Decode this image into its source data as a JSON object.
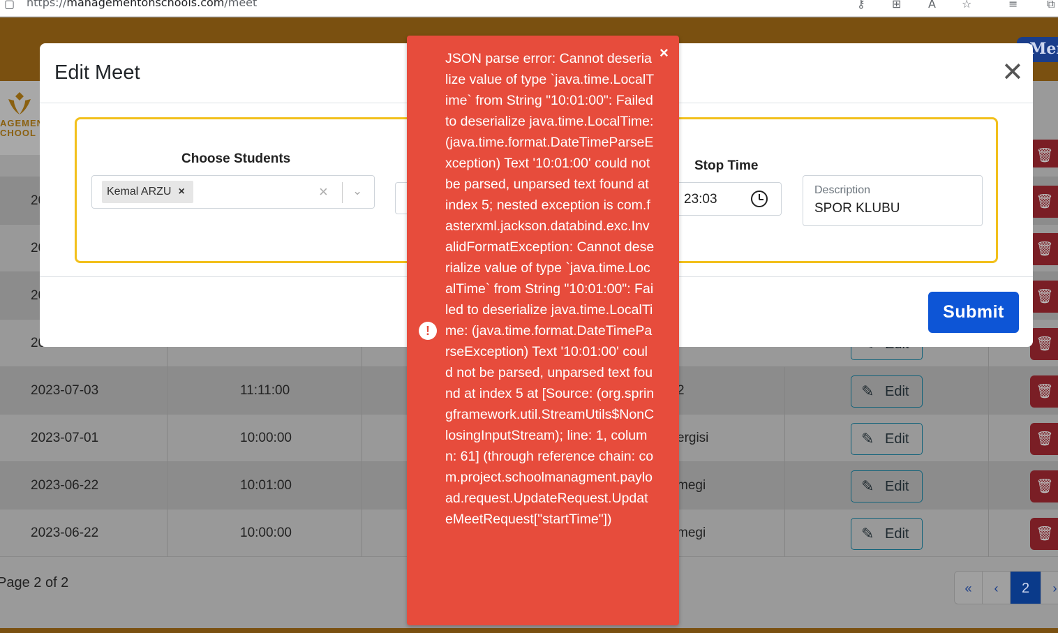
{
  "browser": {
    "url_prefix": "https://",
    "url_host": "managementonschools.com",
    "url_path": "/meet"
  },
  "header": {
    "menu_label": "Men"
  },
  "sidebar": {
    "logo_text_line1": "AGEMEN",
    "logo_text_line2": "CHOOL"
  },
  "table": {
    "rows": [
      {
        "date": "20",
        "start": "",
        "desc": "",
        "edit": ""
      },
      {
        "date": "20",
        "start": "",
        "desc": "",
        "edit": ""
      },
      {
        "date": "20",
        "start": "",
        "desc": "",
        "edit": ""
      },
      {
        "date": "20",
        "start": "",
        "desc": "",
        "edit": "Edit"
      },
      {
        "date": "2023-07-03",
        "start": "11:11:00",
        "desc": "2",
        "edit": "Edit"
      },
      {
        "date": "2023-07-01",
        "start": "10:00:00",
        "desc": "ergisi",
        "edit": "Edit"
      },
      {
        "date": "2023-06-22",
        "start": "10:01:00",
        "desc": "megi",
        "edit": "Edit"
      },
      {
        "date": "2023-06-22",
        "start": "10:00:00",
        "desc": "megi",
        "edit": "Edit"
      }
    ]
  },
  "pagination": {
    "info": "Page 2 of 2",
    "first": "«",
    "prev": "‹",
    "current": "2",
    "next": "›"
  },
  "modal": {
    "title": "Edit Meet",
    "close": "✕",
    "students_label": "Choose Students",
    "selected_student": "Kemal ARZU",
    "chip_remove": "×",
    "clear_icon": "×",
    "arrow_icon": "⌄",
    "stop_time_label": "Stop Time",
    "stop_time_value": "23:03",
    "description_label": "Description",
    "description_value": "SPOR KLUBU",
    "submit": "Submit"
  },
  "toast": {
    "close": "×",
    "icon": "!",
    "message": "JSON parse error: Cannot deserialize value of type `java.time.LocalTime` from String \"10:01:00\": Failed to deserialize java.time.LocalTime: (java.time.format.DateTimeParseException) Text '10:01:00' could not be parsed, unparsed text found at index 5; nested exception is com.fasterxml.jackson.databind.exc.InvalidFormatException: Cannot deserialize value of type `java.time.LocalTime` from String \"10:01:00\": Failed to deserialize java.time.LocalTime: (java.time.format.DateTimeParseException) Text '10:01:00' could not be parsed, unparsed text found at index 5 at [Source: (org.springframework.util.StreamUtils$NonClosingInputStream); line: 1, column: 61] (through reference chain: com.project.schoolmanagment.payload.request.UpdateRequest.UpdateMeetRequest[\"startTime\"])"
  },
  "colors": {
    "toast_bg": "#e74c3c",
    "submit_bg": "#0d55d6",
    "form_border": "#f2c01c",
    "delete_bg": "#7a1e25"
  }
}
